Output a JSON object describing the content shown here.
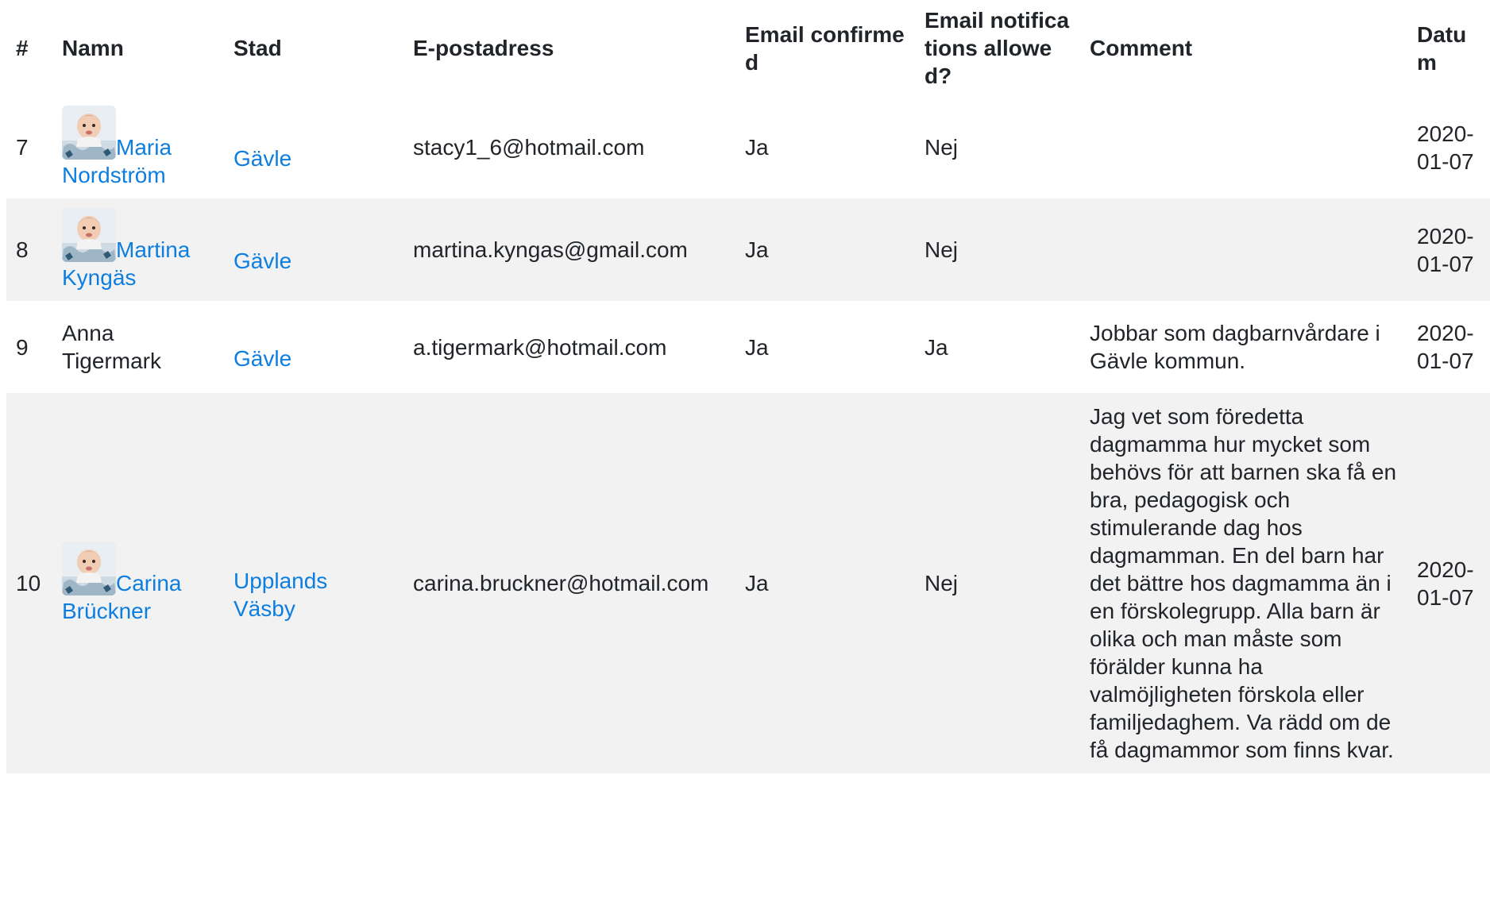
{
  "table": {
    "headers": {
      "num": "#",
      "name": "Namn",
      "city": "Stad",
      "email": "E-postadress",
      "confirmed": "Email confirmed",
      "notifications": "Email notifications allowed?",
      "comment": "Comment",
      "date": "Datum"
    },
    "rows": [
      {
        "num": "7",
        "name": "Maria Nordström",
        "has_avatar": true,
        "city": "Gävle",
        "email": "stacy1_6@hotmail.com",
        "confirmed": "Ja",
        "notifications": "Nej",
        "comment": "",
        "date": "2020-01-07"
      },
      {
        "num": "8",
        "name": "Martina Kyngäs",
        "has_avatar": true,
        "city": "Gävle",
        "email": "martina.kyngas@gmail.com",
        "confirmed": "Ja",
        "notifications": "Nej",
        "comment": "",
        "date": "2020-01-07"
      },
      {
        "num": "9",
        "name": "Anna Tigermark",
        "has_avatar": false,
        "city": "Gävle",
        "email": "a.tigermark@hotmail.com",
        "confirmed": "Ja",
        "notifications": "Ja",
        "comment": "Jobbar som dagbarnvårdare i Gävle kommun.",
        "date": "2020-01-07"
      },
      {
        "num": "10",
        "name": "Carina Brückner",
        "has_avatar": true,
        "city": "Upplands Väsby",
        "email": "carina.bruckner@hotmail.com",
        "confirmed": "Ja",
        "notifications": "Nej",
        "comment": "Jag vet som föredetta dagmamma hur mycket som behövs för att barnen ska få en bra, pedagogisk och stimulerande dag hos dagmamman. En del barn har det bättre hos dagmamma än i en förskolegrupp. Alla barn är olika och man måste som förälder kunna ha valmöjligheten förskola eller familjedaghem. Va rädd om de få dagmammor som finns kvar.",
        "date": "2020-01-07"
      }
    ]
  },
  "colors": {
    "link": "#0d7ee0",
    "stripe": "#f2f2f2",
    "text": "#212529"
  },
  "icons": {
    "avatar": "baby-avatar-icon"
  }
}
